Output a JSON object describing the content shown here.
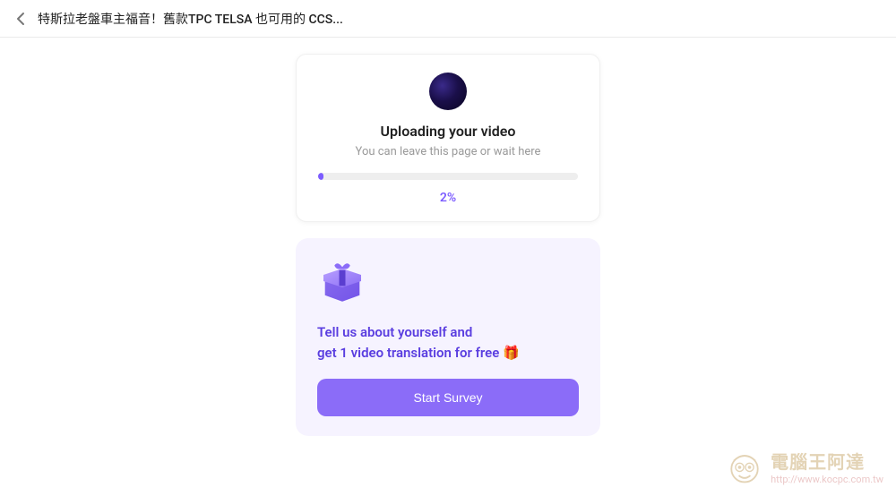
{
  "header": {
    "title": "特斯拉老盤車主福音！舊款TPC TELSA 也可用的 CCS..."
  },
  "upload": {
    "title": "Uploading your video",
    "subtitle": "You can leave this page or wait here",
    "percent": "2%",
    "progress_width": "2%"
  },
  "survey": {
    "line1": "Tell us about yourself and",
    "line2": "get 1 video translation for free",
    "gift_emoji": "🎁",
    "button": "Start Survey"
  },
  "watermark": {
    "title": "電腦王阿達",
    "url": "http://www.kocpc.com.tw"
  }
}
